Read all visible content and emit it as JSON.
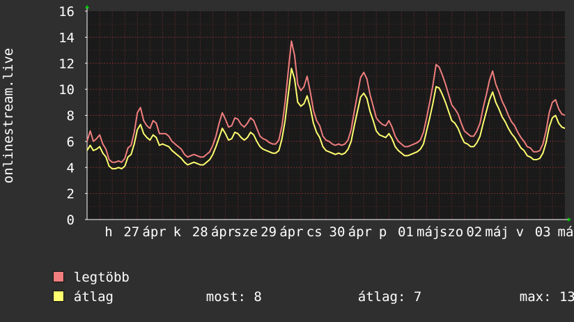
{
  "chart_data": {
    "type": "line",
    "ylabel": "onlinestream.live",
    "ylim": [
      0,
      16
    ],
    "y_ticks": [
      "0",
      "2",
      "4",
      "6",
      "8",
      "10",
      "12",
      "14",
      "16"
    ],
    "x_tick_labels": [
      "h",
      "27",
      "ápr",
      "k",
      "28",
      "ápr",
      "sze",
      "29",
      "ápr",
      "cs",
      "30",
      "ápr",
      "p",
      "01",
      "máj",
      "szo",
      "02",
      "máj",
      "v",
      "03",
      "má"
    ],
    "grid": true,
    "background": "#1a1a1a",
    "grid_color": "#7a2e2e",
    "series": [
      {
        "name": "legtöbb",
        "color": "#f07e7e",
        "values": [
          6.0,
          6.8,
          6.0,
          6.2,
          6.5,
          5.8,
          5.4,
          4.6,
          4.4,
          4.4,
          4.5,
          4.4,
          4.7,
          5.5,
          5.7,
          6.7,
          8.2,
          8.6,
          7.6,
          7.2,
          7.0,
          7.6,
          7.4,
          6.6,
          6.6,
          6.6,
          6.4,
          6.0,
          5.8,
          5.6,
          5.4,
          5.0,
          4.8,
          4.9,
          5.0,
          4.9,
          4.8,
          4.8,
          5.0,
          5.2,
          5.7,
          6.4,
          7.4,
          8.2,
          7.7,
          7.1,
          7.2,
          7.8,
          7.7,
          7.3,
          7.1,
          7.4,
          7.8,
          7.6,
          7.0,
          6.4,
          6.2,
          6.1,
          5.9,
          5.8,
          5.8,
          6.1,
          7.2,
          9.0,
          11.4,
          13.7,
          12.6,
          10.4,
          9.9,
          10.2,
          11.0,
          9.8,
          8.4,
          7.6,
          7.2,
          6.4,
          6.1,
          6.0,
          5.8,
          5.7,
          5.8,
          5.7,
          5.8,
          6.1,
          6.9,
          8.3,
          9.6,
          10.9,
          11.3,
          10.8,
          9.6,
          8.7,
          7.8,
          7.5,
          7.3,
          7.2,
          7.6,
          7.1,
          6.4,
          6.0,
          5.8,
          5.6,
          5.6,
          5.7,
          5.8,
          5.9,
          6.1,
          6.7,
          7.8,
          9.0,
          10.3,
          11.9,
          11.7,
          11.1,
          10.4,
          9.6,
          8.8,
          8.5,
          8.1,
          7.4,
          6.8,
          6.6,
          6.4,
          6.4,
          6.8,
          7.4,
          8.6,
          9.6,
          10.7,
          11.4,
          10.4,
          9.8,
          9.1,
          8.6,
          8.0,
          7.5,
          7.2,
          6.7,
          6.3,
          6.0,
          5.6,
          5.5,
          5.2,
          5.2,
          5.3,
          5.8,
          6.8,
          8.2,
          9.0,
          9.2,
          8.5,
          8.1,
          8.0
        ],
        "ui_label": "legtöbb"
      },
      {
        "name": "átlag",
        "color": "#ffff70",
        "values": [
          5.3,
          5.7,
          5.3,
          5.4,
          5.6,
          5.1,
          4.8,
          4.1,
          3.9,
          3.9,
          4.0,
          3.9,
          4.1,
          4.8,
          5.0,
          5.8,
          6.9,
          7.3,
          6.6,
          6.3,
          6.1,
          6.5,
          6.3,
          5.7,
          5.8,
          5.7,
          5.6,
          5.3,
          5.1,
          4.9,
          4.7,
          4.4,
          4.2,
          4.3,
          4.4,
          4.3,
          4.2,
          4.2,
          4.4,
          4.6,
          5.0,
          5.6,
          6.3,
          7.0,
          6.6,
          6.1,
          6.2,
          6.7,
          6.6,
          6.3,
          6.1,
          6.3,
          6.7,
          6.5,
          6.0,
          5.6,
          5.4,
          5.3,
          5.2,
          5.1,
          5.1,
          5.3,
          6.2,
          7.6,
          9.6,
          11.6,
          10.8,
          9.0,
          8.7,
          8.9,
          9.5,
          8.6,
          7.4,
          6.7,
          6.3,
          5.6,
          5.3,
          5.2,
          5.1,
          5.0,
          5.1,
          5.0,
          5.1,
          5.4,
          6.0,
          7.2,
          8.3,
          9.4,
          9.7,
          9.3,
          8.3,
          7.6,
          6.8,
          6.5,
          6.4,
          6.3,
          6.6,
          6.2,
          5.6,
          5.3,
          5.1,
          4.9,
          4.9,
          5.0,
          5.1,
          5.2,
          5.4,
          5.8,
          6.8,
          7.8,
          8.9,
          10.2,
          10.1,
          9.6,
          9.0,
          8.3,
          7.6,
          7.4,
          7.0,
          6.4,
          5.9,
          5.8,
          5.6,
          5.6,
          5.9,
          6.4,
          7.4,
          8.3,
          9.2,
          9.8,
          9.0,
          8.5,
          7.9,
          7.5,
          7.0,
          6.6,
          6.3,
          5.9,
          5.5,
          5.3,
          4.9,
          4.8,
          4.6,
          4.6,
          4.7,
          5.1,
          5.9,
          7.1,
          7.8,
          8.0,
          7.4,
          7.1,
          7.0
        ],
        "ui_label": "átlag"
      }
    ]
  },
  "stats": {
    "most_label": "most:",
    "most_value": "8",
    "atlag_label": "átlag:",
    "atlag_value": "7",
    "max_label": "max:",
    "max_value": "13"
  }
}
